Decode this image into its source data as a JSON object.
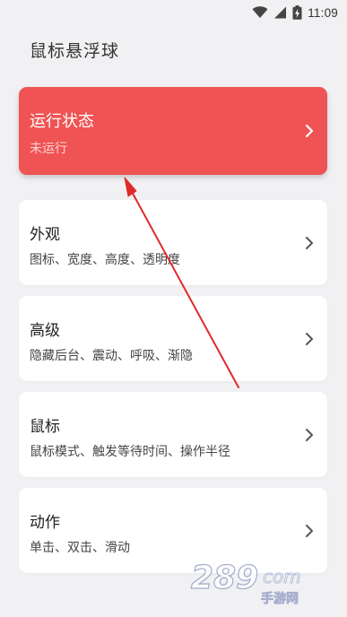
{
  "status_bar": {
    "time": "11:09"
  },
  "header": {
    "title": "鼠标悬浮球"
  },
  "cards": [
    {
      "title": "运行状态",
      "subtitle": "未运行"
    },
    {
      "title": "外观",
      "subtitle": "图标、宽度、高度、透明度"
    },
    {
      "title": "高级",
      "subtitle": "隐藏后台、震动、呼吸、渐隐"
    },
    {
      "title": "鼠标",
      "subtitle": "鼠标模式、触发等待时间、操作半径"
    },
    {
      "title": "动作",
      "subtitle": "单击、双击、滑动"
    }
  ],
  "colors": {
    "primary_card": "#ef5353",
    "background": "#f1f1f3",
    "annotation_arrow": "#e02a2a"
  },
  "watermark": {
    "main": "289",
    "suffix": "com",
    "sub": "手游网"
  }
}
